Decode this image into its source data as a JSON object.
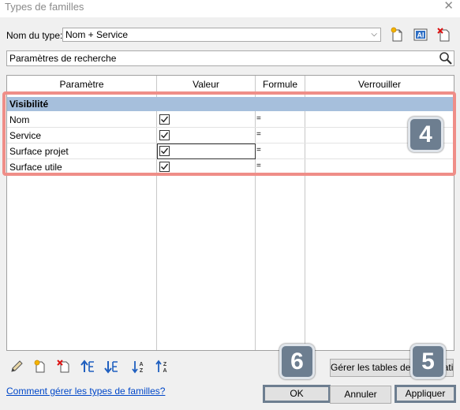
{
  "window": {
    "title": "Types de familles",
    "close_glyph": "✕"
  },
  "type_selector": {
    "label": "Nom du type:",
    "value": "Nom + Service"
  },
  "toolbar_icons": [
    "new-type-icon",
    "rename-type-icon",
    "delete-type-icon"
  ],
  "search": {
    "placeholder": "Paramètres de recherche"
  },
  "table": {
    "headers": [
      "Paramètre",
      "Valeur",
      "Formule",
      "Verrouiller"
    ],
    "group": {
      "label": "Visibilité"
    },
    "rows": [
      {
        "name": "Nom",
        "checked": true,
        "formula": "="
      },
      {
        "name": "Service",
        "checked": true,
        "formula": "="
      },
      {
        "name": "Surface projet",
        "checked": true,
        "formula": "="
      },
      {
        "name": "Surface utile",
        "checked": true,
        "formula": "="
      }
    ]
  },
  "callouts": {
    "badge_4": "4",
    "badge_5": "5",
    "badge_6": "6"
  },
  "bottom_toolbar_icons": [
    "edit-parameter-icon",
    "new-parameter-icon",
    "delete-parameter-icon",
    "move-up-icon",
    "move-down-icon",
    "sort-ascending-icon",
    "sort-descending-icon"
  ],
  "buttons": {
    "lookup_tables": "Gérer les tables de consultation",
    "ok": "OK",
    "cancel": "Annuler",
    "apply": "Appliquer"
  },
  "help_link": "Comment gérer les types de familles?",
  "colors": {
    "group_header": "#a6bfdc",
    "highlight": "#ef8e88",
    "badge": "#6d7e90",
    "link": "#0047c8"
  }
}
